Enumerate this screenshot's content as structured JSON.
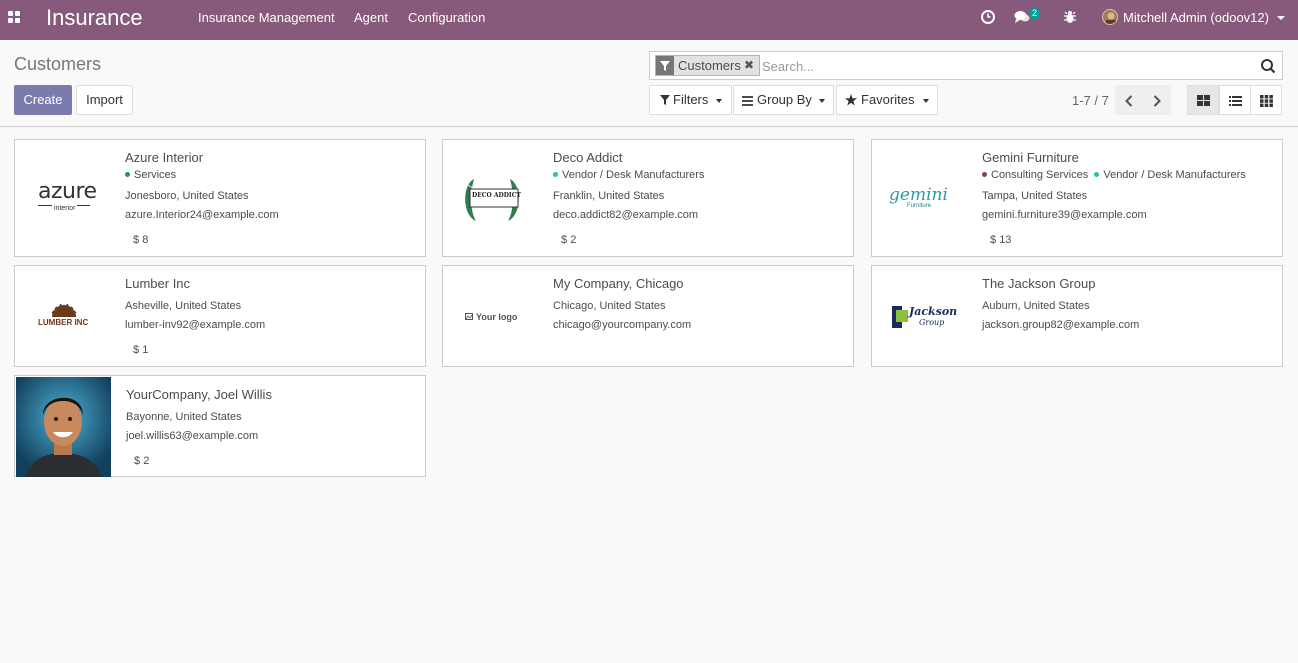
{
  "navbar": {
    "brand": "Insurance",
    "menu": [
      "Insurance Management",
      "Agent",
      "Configuration"
    ],
    "messages_badge": "2",
    "user": "Mitchell Admin (odoov12)",
    "bg_color": "#875a7b"
  },
  "control_panel": {
    "breadcrumb": "Customers",
    "create_label": "Create",
    "import_label": "Import",
    "search": {
      "facet": "Customers",
      "placeholder": "Search..."
    },
    "filters_label": "Filters",
    "group_by_label": "Group By",
    "favorites_label": "Favorites",
    "pager": "1-7 / 7"
  },
  "cards": [
    {
      "name": "Azure Interior",
      "tags": [
        {
          "label": "Services",
          "color": "#2c8397"
        }
      ],
      "location": "Jonesboro, United States",
      "email": "azure.Interior24@example.com",
      "count": "8",
      "logo": "azure-logo"
    },
    {
      "name": "Deco Addict",
      "tags": [
        {
          "label": "Vendor / Desk Manufacturers",
          "color": "#30c381"
        }
      ],
      "location": "Franklin, United States",
      "email": "deco.addict82@example.com",
      "count": "2",
      "logo": "deco-addict-logo"
    },
    {
      "name": "Gemini Furniture",
      "tags": [
        {
          "label": "Consulting Services",
          "color": "#893b6c"
        },
        {
          "label": "Vendor / Desk Manufacturers",
          "color": "#30c381"
        }
      ],
      "location": "Tampa, United States",
      "email": "gemini.furniture39@example.com",
      "count": "13",
      "logo": "gemini-logo"
    },
    {
      "name": "Lumber Inc",
      "tags": [],
      "location": "Asheville, United States",
      "email": "lumber-inv92@example.com",
      "count": "1",
      "logo": "lumber-logo"
    },
    {
      "name": "My Company, Chicago",
      "tags": [],
      "location": "Chicago, United States",
      "email": "chicago@yourcompany.com",
      "count": "",
      "logo": "your-logo"
    },
    {
      "name": "The Jackson Group",
      "tags": [],
      "location": "Auburn, United States",
      "email": "jackson.group82@example.com",
      "count": "",
      "logo": "jackson-logo"
    },
    {
      "name": "YourCompany, Joel Willis",
      "tags": [],
      "location": "Bayonne, United States",
      "email": "joel.willis63@example.com",
      "count": "2",
      "logo": "joel-photo"
    }
  ],
  "logos": {
    "azure_word": "azure",
    "azure_sub": "interior",
    "deco": "DECO ADDICT",
    "gemini_word": "gemini",
    "gemini_sub": "Furniture",
    "lumber": "LUMBER INC",
    "your_logo": "Your logo",
    "jackson_line1": "Jackson",
    "jackson_line2": "Group"
  }
}
